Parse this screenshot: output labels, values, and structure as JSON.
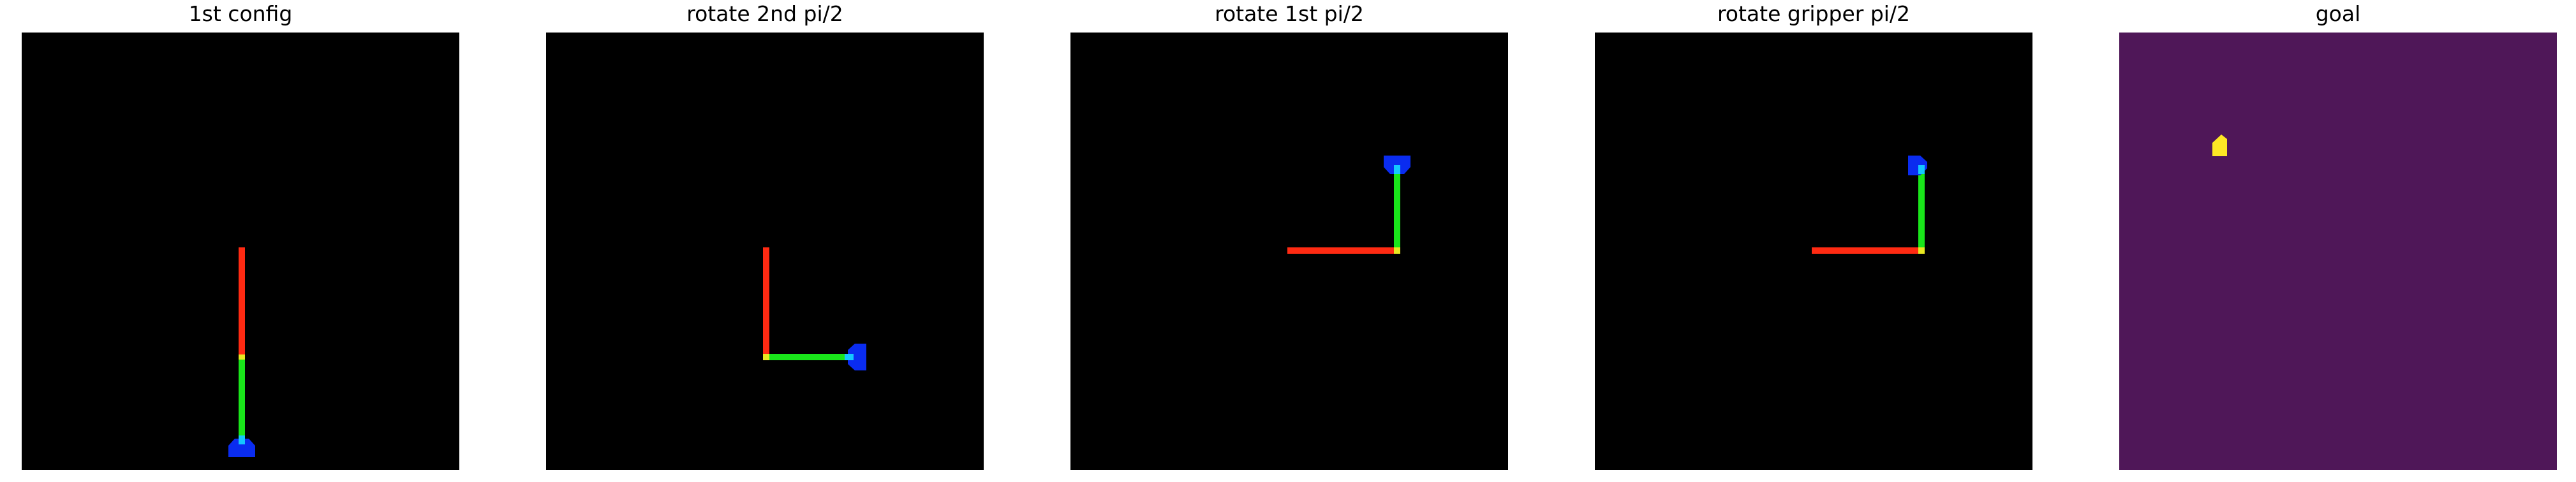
{
  "panels": [
    {
      "title": "1st config"
    },
    {
      "title": "rotate 2nd pi/2"
    },
    {
      "title": "rotate 1st pi/2"
    },
    {
      "title": "rotate gripper pi/2"
    },
    {
      "title": "goal"
    }
  ],
  "colors": {
    "background": "#000000",
    "goal_background": "#4f1758",
    "link_1": "#ff2a12",
    "link_2": "#19e61a",
    "joint": "#e8e821",
    "gripper": "#0a2cf0",
    "gripper_tip": "#14c8ff",
    "goal_marker": "#fde725"
  }
}
